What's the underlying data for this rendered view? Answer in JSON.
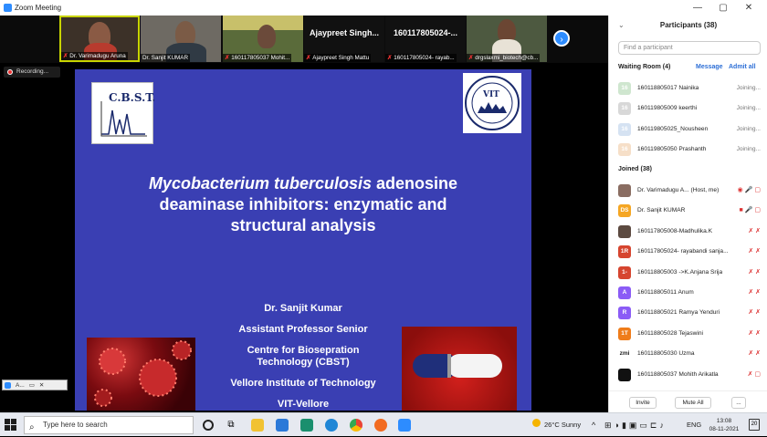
{
  "window": {
    "title": "Zoom Meeting",
    "controls": [
      "—",
      "▢",
      "✕"
    ]
  },
  "strip": {
    "tiles": [
      {
        "name": "Dr. Varimadugu Aruna",
        "muted": true
      },
      {
        "name": "Dr. Sanjit KUMAR",
        "muted": false
      },
      {
        "name": "160117805037 Mohit...",
        "muted": true
      },
      {
        "name": "Ajaypreet Singh Mattu",
        "big": "Ajaypreet Singh...",
        "muted": true
      },
      {
        "name": "160117805024- rayab...",
        "big": "160117805024-...",
        "muted": true
      },
      {
        "name": "drgslaxmi_biotech@cb...",
        "muted": true
      }
    ]
  },
  "recording": {
    "label": "Recording..."
  },
  "slide": {
    "title_italic": "Mycobacterium tuberculosis",
    "title_rest_1": " adenosine",
    "title_line_2": "deaminase inhibitors: enzymatic and",
    "title_line_3": "structural analysis",
    "logo_left": "C.B.S.T.",
    "logo_right": "VIT",
    "author": "Dr. Sanjit Kumar",
    "position": "Assistant Professor Senior",
    "centre": "Centre for Biosepration",
    "centre_2": "Technology (CBST)",
    "institute": "Vellore Institute of Technology",
    "city": "VIT-Vellore"
  },
  "mini_window": {
    "label": "A..."
  },
  "participants": {
    "header": "Participants (38)",
    "search_placeholder": "Find a participant",
    "waiting_room": "Waiting Room (4)",
    "message": "Message",
    "admit_all": "Admit all",
    "joined_label": "Joined (38)",
    "waiting": [
      {
        "initials": "16",
        "name": "160118805017 Nainika",
        "status": "Joining...",
        "color": "#cfe6cf"
      },
      {
        "initials": "16",
        "name": "160119805009 keerthi",
        "status": "Joining...",
        "color": "#d8d8d8"
      },
      {
        "initials": "16",
        "name": "160119805025_Nousheen",
        "status": "Joining...",
        "color": "#d5e2f2"
      },
      {
        "initials": "16",
        "name": "160119805050 Prashanth",
        "status": "Joining...",
        "color": "#f6dfc8"
      }
    ],
    "joined": [
      {
        "initials": "",
        "name": "Dr. Varimadugu A... (Host, me)",
        "color": "#8a6d62",
        "icons": "◉ 🎤 ▢"
      },
      {
        "initials": "DS",
        "name": "Dr. Sanjit KUMAR",
        "color": "#f5a623",
        "icons": "■ 🎤 ▢"
      },
      {
        "initials": "",
        "name": "160117805008-Madhulika.K",
        "color": "#5c4a40",
        "icons": "✗ ✗"
      },
      {
        "initials": "1R",
        "name": "160117805024- rayabandi sanja...",
        "color": "#d6452f",
        "icons": "✗ ✗"
      },
      {
        "initials": "1-",
        "name": "160118805003 ->K.Anjana Srija",
        "color": "#d6452f",
        "icons": "✗ ✗"
      },
      {
        "initials": "A",
        "name": "160118805011 Anum",
        "color": "#8b5cf6",
        "icons": "✗ ✗"
      },
      {
        "initials": "R",
        "name": "160118805021 Ramya Yenduri",
        "color": "#8b5cf6",
        "icons": "✗ ✗"
      },
      {
        "initials": "1T",
        "name": "160118805028 Tejaswini",
        "color": "#ef7c1a",
        "icons": "✗ ✗"
      },
      {
        "initials": "zmi",
        "name": "160118805030 Uzma",
        "color": "#ffffff",
        "icons": "✗ ✗"
      },
      {
        "initials": "",
        "name": "160118805037 Mohith Arikatla",
        "color": "#111111",
        "icons": "✗ ▢"
      }
    ],
    "invite": "Invite",
    "mute_all": "Mute All",
    "more": "..."
  },
  "taskbar": {
    "search_placeholder": "Type here to search",
    "weather": "26°C  Sunny",
    "lang": "ENG",
    "time": "13:08",
    "date": "08-11-2021",
    "notifications": "20"
  }
}
